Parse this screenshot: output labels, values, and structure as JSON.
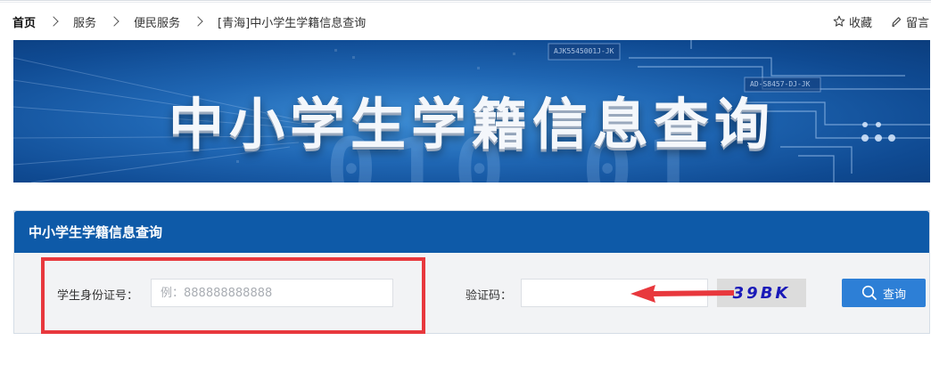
{
  "breadcrumb": {
    "items": [
      "首页",
      "服务",
      "便民服务",
      "[青海]中小学生学籍信息查询"
    ]
  },
  "actions": {
    "favorite_label": "收藏",
    "message_label": "留言",
    "favorite_icon": "star-icon",
    "message_icon": "pen-icon"
  },
  "banner": {
    "title": "中小学生学籍信息查询",
    "digits": "010 01",
    "chip_labels": [
      "AJK5545001J-JK",
      "AD-S8457-DJ-JK"
    ]
  },
  "panel": {
    "title": "中小学生学籍信息查询",
    "id_label": "学生身份证号：",
    "id_placeholder": "例：888888888888",
    "id_value": "",
    "captcha_label": "验证码：",
    "captcha_value": "",
    "captcha_text": "39BK",
    "query_label": "查询",
    "query_icon": "search-icon"
  },
  "colors": {
    "header_blue": "#0e5aa8",
    "button_blue": "#2d7fd6",
    "annotation_red": "#e8383d",
    "captcha_text": "#1a1ab8"
  }
}
